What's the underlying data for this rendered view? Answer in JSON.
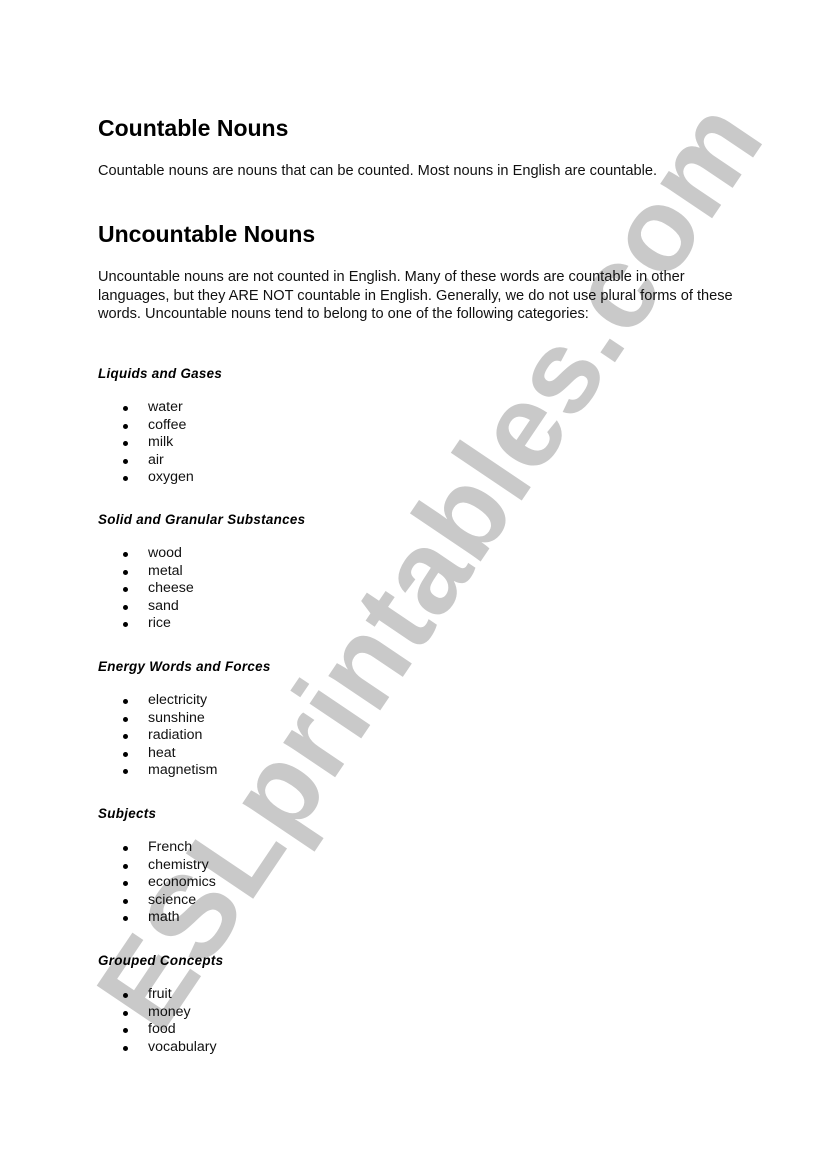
{
  "watermark": {
    "text": "ESLprintables.com",
    "color": "#c9c9c9"
  },
  "sections": {
    "countable": {
      "title": "Countable Nouns",
      "text": "Countable nouns are nouns that can be counted. Most nouns in English are countable."
    },
    "uncountable": {
      "title": "Uncountable Nouns",
      "text": "Uncountable nouns are not counted in English. Many of these words are countable in other languages, but they ARE NOT countable in English. Generally, we do not use plural forms of these words. Uncountable nouns tend to belong to one of the following categories:"
    }
  },
  "categories": [
    {
      "heading": "Liquids and Gases",
      "items": [
        "water",
        "coffee",
        "milk",
        "air",
        "oxygen"
      ]
    },
    {
      "heading": "Solid and Granular Substances",
      "items": [
        "wood",
        "metal",
        "cheese",
        "sand",
        "rice"
      ]
    },
    {
      "heading": "Energy Words and Forces",
      "items": [
        "electricity",
        "sunshine",
        "radiation",
        "heat",
        "magnetism"
      ]
    },
    {
      "heading": "Subjects",
      "items": [
        "French",
        "chemistry",
        "economics",
        "science",
        "math"
      ]
    },
    {
      "heading": "Grouped Concepts",
      "items": [
        "fruit",
        "money",
        "food",
        "vocabulary"
      ]
    }
  ]
}
